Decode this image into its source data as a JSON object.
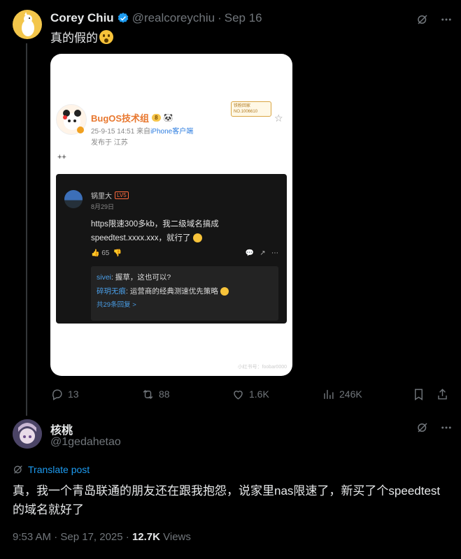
{
  "tweet1": {
    "name": "Corey Chiu",
    "handle": "@realcoreychiu",
    "separator": "·",
    "date": "Sep 16",
    "text": "真的假的",
    "icons": {
      "grok": "grok-icon",
      "more": "more-icon",
      "verified": "verified-badge-icon",
      "emoji": "surprised-face-icon"
    }
  },
  "embedded_post": {
    "author": "BugOS技术组",
    "badge": "8",
    "meta_time": "25-9-15 14:51",
    "meta_from": "来自",
    "meta_client": "iPhone客户端",
    "location": "发布于 江苏",
    "fan_badge_line1": "铁粉回家",
    "fan_badge_line2": "NO.1006610",
    "body": "++",
    "comment": {
      "user": "锅里大",
      "level": "LV5",
      "date": "8月29日",
      "text": "https限速300多kb，我二级域名搞成speedtest.xxxx.xxx，就行了",
      "likes": "65",
      "replies": [
        {
          "user": "sivei",
          "text": ": 握草，这也可以?"
        },
        {
          "user": "碎玥无痕",
          "text": ": 运营商的经典测速优先策略"
        }
      ],
      "more_replies": "共29条回复 >"
    },
    "watermark": "小红书号：foobar0000"
  },
  "action_bar": {
    "replies": "13",
    "reposts": "88",
    "likes": "1.6K",
    "views": "246K"
  },
  "tweet2": {
    "name": "核桃",
    "handle": "@1gedahetao",
    "translate_label": "Translate post",
    "text": "真，我一个青岛联通的朋友还在跟我抱怨，说家里nas限速了，新买了个speedtest的域名就好了",
    "time": "9:53 AM · Sep 17, 2025 · ",
    "views_count": "12.7K",
    "views_label": " Views"
  }
}
